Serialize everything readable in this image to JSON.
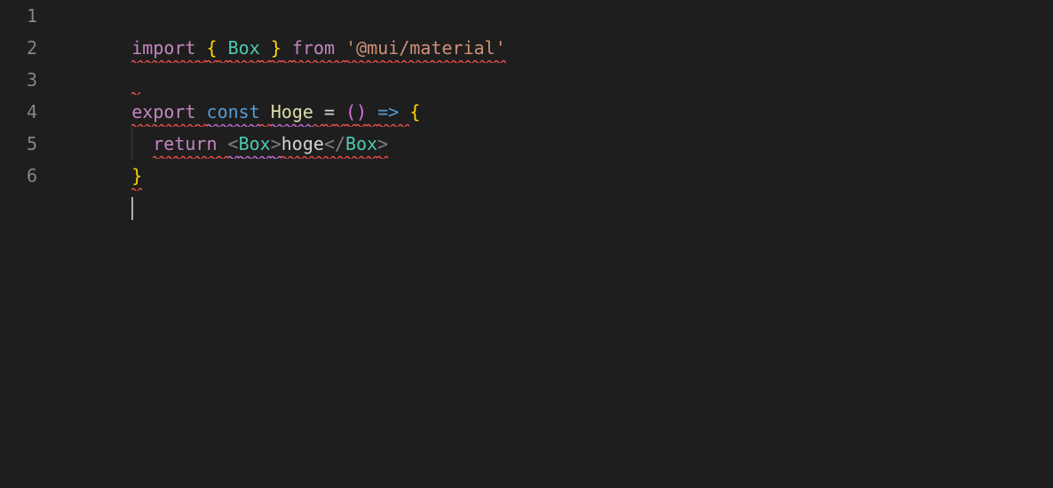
{
  "gutter": {
    "lines": [
      "1",
      "2",
      "3",
      "4",
      "5",
      "6"
    ]
  },
  "code": {
    "l1": {
      "import": "import",
      "sp1": " ",
      "lbrace": "{",
      "sp2": " ",
      "box": "Box",
      "sp3": " ",
      "rbrace": "}",
      "sp4": " ",
      "from": "from",
      "sp5": " ",
      "str": "'@mui/material'"
    },
    "l3": {
      "export": "export",
      "sp1": " ",
      "const": "const",
      "sp2": " ",
      "name": "Hoge",
      "sp3": " ",
      "eq": "=",
      "sp4": " ",
      "lp": "(",
      "rp": ")",
      "sp5": " ",
      "arrow": "=>",
      "sp6": " ",
      "lbrace": "{"
    },
    "l4": {
      "return": "return",
      "sp1": " ",
      "lt1": "<",
      "tag1": "Box",
      "gt1": ">",
      "text": "hoge",
      "lt2": "</",
      "tag2": "Box",
      "gt2": ">"
    },
    "l5": {
      "rbrace": "}"
    }
  }
}
